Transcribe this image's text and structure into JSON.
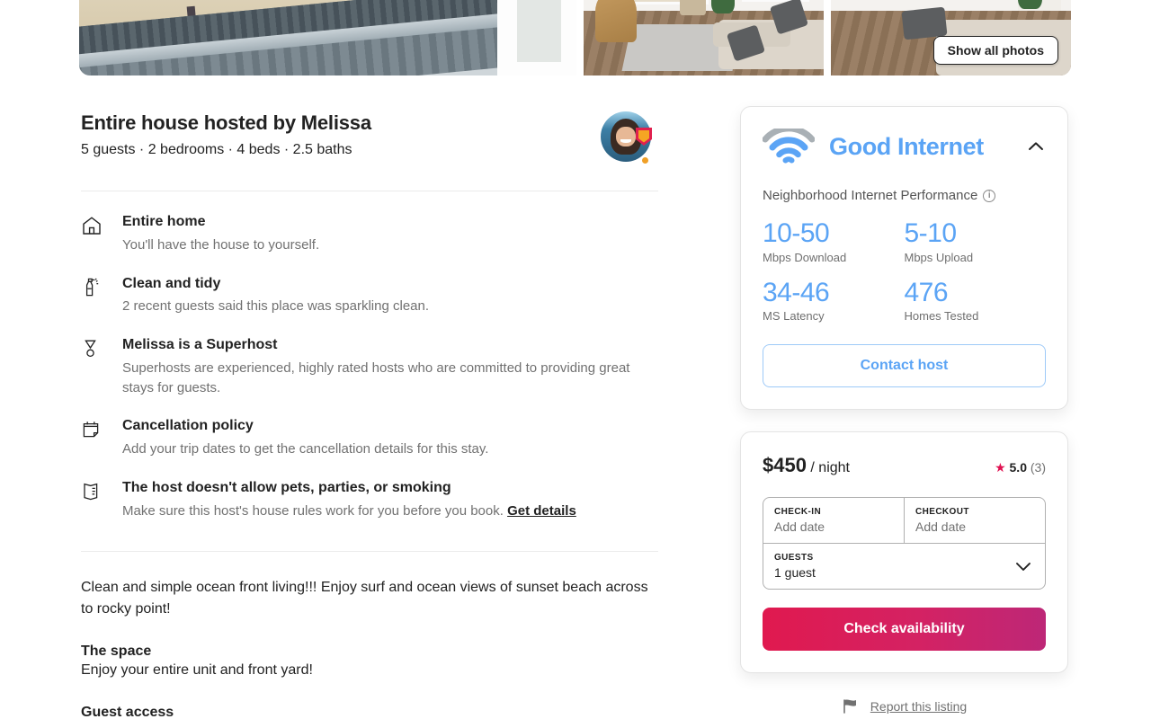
{
  "gallery": {
    "show_all_label": "Show all photos",
    "photos": [
      {
        "name": "beach-deck-view"
      },
      {
        "name": "living-room"
      },
      {
        "name": "dining-area"
      }
    ]
  },
  "host": {
    "title": "Entire house hosted by Melissa",
    "subtitle": "5 guests · 2 bedrooms · 4 beds · 2.5 baths",
    "avatar_name": "melissa-avatar",
    "superhost_badge": "superhost-badge"
  },
  "features": [
    {
      "icon": "house-icon",
      "title": "Entire home",
      "desc": "You'll have the house to yourself."
    },
    {
      "icon": "spray-bottle-icon",
      "title": "Clean and tidy",
      "desc": "2 recent guests said this place was sparkling clean."
    },
    {
      "icon": "superhost-medal-icon",
      "title": "Melissa is a Superhost",
      "desc": "Superhosts are experienced, highly rated hosts who are committed to providing great stays for guests."
    },
    {
      "icon": "calendar-icon",
      "title": "Cancellation policy",
      "desc": "Add your trip dates to get the cancellation details for this stay."
    },
    {
      "icon": "house-rules-icon",
      "title": "The host doesn't allow pets, parties, or smoking",
      "desc": "Make sure this host's house rules work for you before you book.",
      "link": "Get details"
    }
  ],
  "about": {
    "intro": "Clean and simple ocean front living!!! Enjoy surf and ocean views of sunset beach across to rocky point!",
    "sections": [
      {
        "heading": "The space",
        "body": "Enjoy your entire unit and front yard!"
      },
      {
        "heading": "Guest access",
        "body": ""
      }
    ]
  },
  "internet": {
    "title": "Good Internet",
    "wifi_icon": "wifi-icon",
    "collapse_icon": "chevron-up-icon",
    "performance_label": "Neighborhood Internet Performance",
    "info_icon": "info-icon",
    "stats": [
      {
        "value": "10-50",
        "label": "Mbps Download"
      },
      {
        "value": "5-10",
        "label": "Mbps Upload"
      },
      {
        "value": "34-46",
        "label": "MS Latency"
      },
      {
        "value": "476",
        "label": "Homes Tested"
      }
    ],
    "contact_label": "Contact host",
    "accent_color": "#5BA4F5"
  },
  "booking": {
    "price": "$450",
    "price_unit": "/ night",
    "star_icon": "star-icon",
    "rating": "5.0",
    "review_count": "(3)",
    "checkin_label": "CHECK-IN",
    "checkin_value": "Add date",
    "checkout_label": "CHECKOUT",
    "checkout_value": "Add date",
    "guests_label": "GUESTS",
    "guests_value": "1 guest",
    "guests_chevron": "chevron-down-icon",
    "cta_label": "Check availability",
    "cta_color": "#d42263"
  },
  "report": {
    "flag_icon": "flag-icon",
    "label": "Report this listing"
  }
}
